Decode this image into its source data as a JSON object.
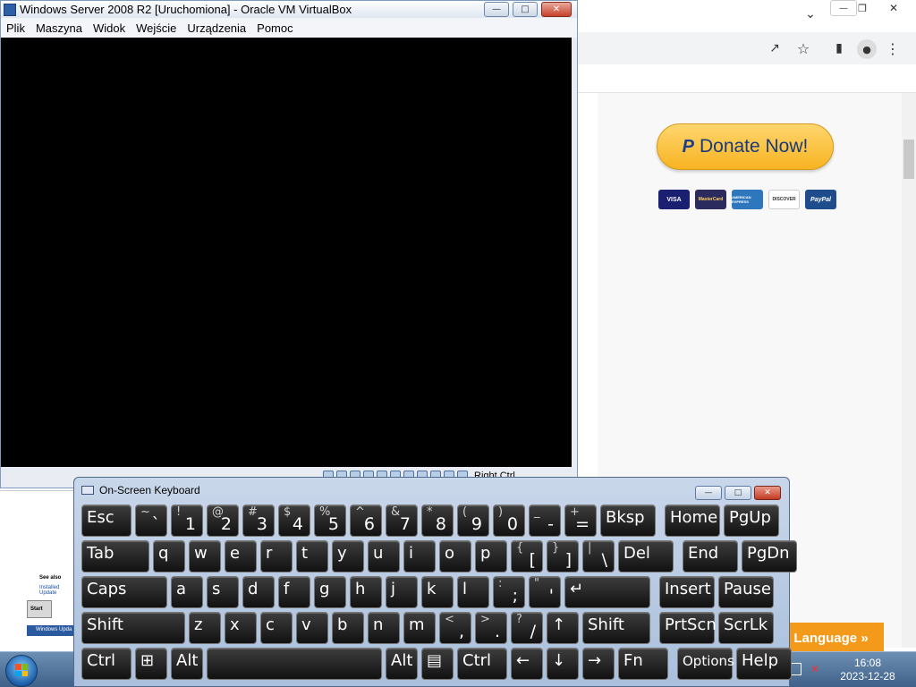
{
  "vbox": {
    "title": "Windows Server 2008 R2 [Uruchomiona] - Oracle VM VirtualBox",
    "menu": [
      "Plik",
      "Maszyna",
      "Widok",
      "Wejście",
      "Urządzenia",
      "Pomoc"
    ],
    "host_key": "Right Ctrl"
  },
  "browser": {
    "donate_label": "Donate Now!",
    "donate_brand": "P",
    "cards": [
      "VISA",
      "MasterCard",
      "AMERICAN EXPRESS",
      "DISCOVER",
      "PayPal"
    ],
    "language_button": "Language »"
  },
  "guest_peek": {
    "see_also": "See also",
    "installed_updates": "Installed Update",
    "start": "Start",
    "windows_update": "Windows Upda"
  },
  "osk": {
    "title": "On-Screen Keyboard",
    "rows": [
      [
        {
          "main": "Esc"
        },
        {
          "shift": "~",
          "base": "`"
        },
        {
          "shift": "!",
          "base": "1"
        },
        {
          "shift": "@",
          "base": "2"
        },
        {
          "shift": "#",
          "base": "3"
        },
        {
          "shift": "$",
          "base": "4"
        },
        {
          "shift": "%",
          "base": "5"
        },
        {
          "shift": "^",
          "base": "6"
        },
        {
          "shift": "&",
          "base": "7"
        },
        {
          "shift": "*",
          "base": "8"
        },
        {
          "shift": "(",
          "base": "9"
        },
        {
          "shift": ")",
          "base": "0"
        },
        {
          "shift": "_",
          "base": "-"
        },
        {
          "shift": "+",
          "base": "="
        },
        {
          "main": "Bksp"
        },
        {
          "main": "Home"
        },
        {
          "main": "PgUp"
        }
      ],
      [
        {
          "main": "Tab"
        },
        {
          "main": "q"
        },
        {
          "main": "w"
        },
        {
          "main": "e"
        },
        {
          "main": "r"
        },
        {
          "main": "t"
        },
        {
          "main": "y"
        },
        {
          "main": "u"
        },
        {
          "main": "i"
        },
        {
          "main": "o"
        },
        {
          "main": "p"
        },
        {
          "shift": "{",
          "base": "["
        },
        {
          "shift": "}",
          "base": "]"
        },
        {
          "shift": "|",
          "base": "\\"
        },
        {
          "main": "Del"
        },
        {
          "main": "End"
        },
        {
          "main": "PgDn"
        }
      ],
      [
        {
          "main": "Caps"
        },
        {
          "main": "a"
        },
        {
          "main": "s"
        },
        {
          "main": "d"
        },
        {
          "main": "f"
        },
        {
          "main": "g"
        },
        {
          "main": "h"
        },
        {
          "main": "j"
        },
        {
          "main": "k"
        },
        {
          "main": "l"
        },
        {
          "shift": ":",
          "base": ";"
        },
        {
          "shift": "\"",
          "base": "'"
        },
        {
          "main": "↵"
        },
        {
          "main": "Insert"
        },
        {
          "main": "Pause"
        }
      ],
      [
        {
          "main": "Shift"
        },
        {
          "main": "z"
        },
        {
          "main": "x"
        },
        {
          "main": "c"
        },
        {
          "main": "v"
        },
        {
          "main": "b"
        },
        {
          "main": "n"
        },
        {
          "main": "m"
        },
        {
          "shift": "<",
          "base": ","
        },
        {
          "shift": ">",
          "base": "."
        },
        {
          "shift": "?",
          "base": "/"
        },
        {
          "main": "↑"
        },
        {
          "main": "Shift"
        },
        {
          "main": "PrtScn"
        },
        {
          "main": "ScrLk"
        }
      ],
      [
        {
          "main": "Ctrl"
        },
        {
          "main": "⊞"
        },
        {
          "main": "Alt"
        },
        {
          "main": ""
        },
        {
          "main": "Alt"
        },
        {
          "main": "▤"
        },
        {
          "main": "Ctrl"
        },
        {
          "main": "←"
        },
        {
          "main": "↓"
        },
        {
          "main": "→"
        },
        {
          "main": "Fn"
        },
        {
          "main": "Options"
        },
        {
          "main": "Help"
        }
      ]
    ]
  },
  "taskbar": {
    "time": "16:08",
    "date": "2023-12-28"
  }
}
